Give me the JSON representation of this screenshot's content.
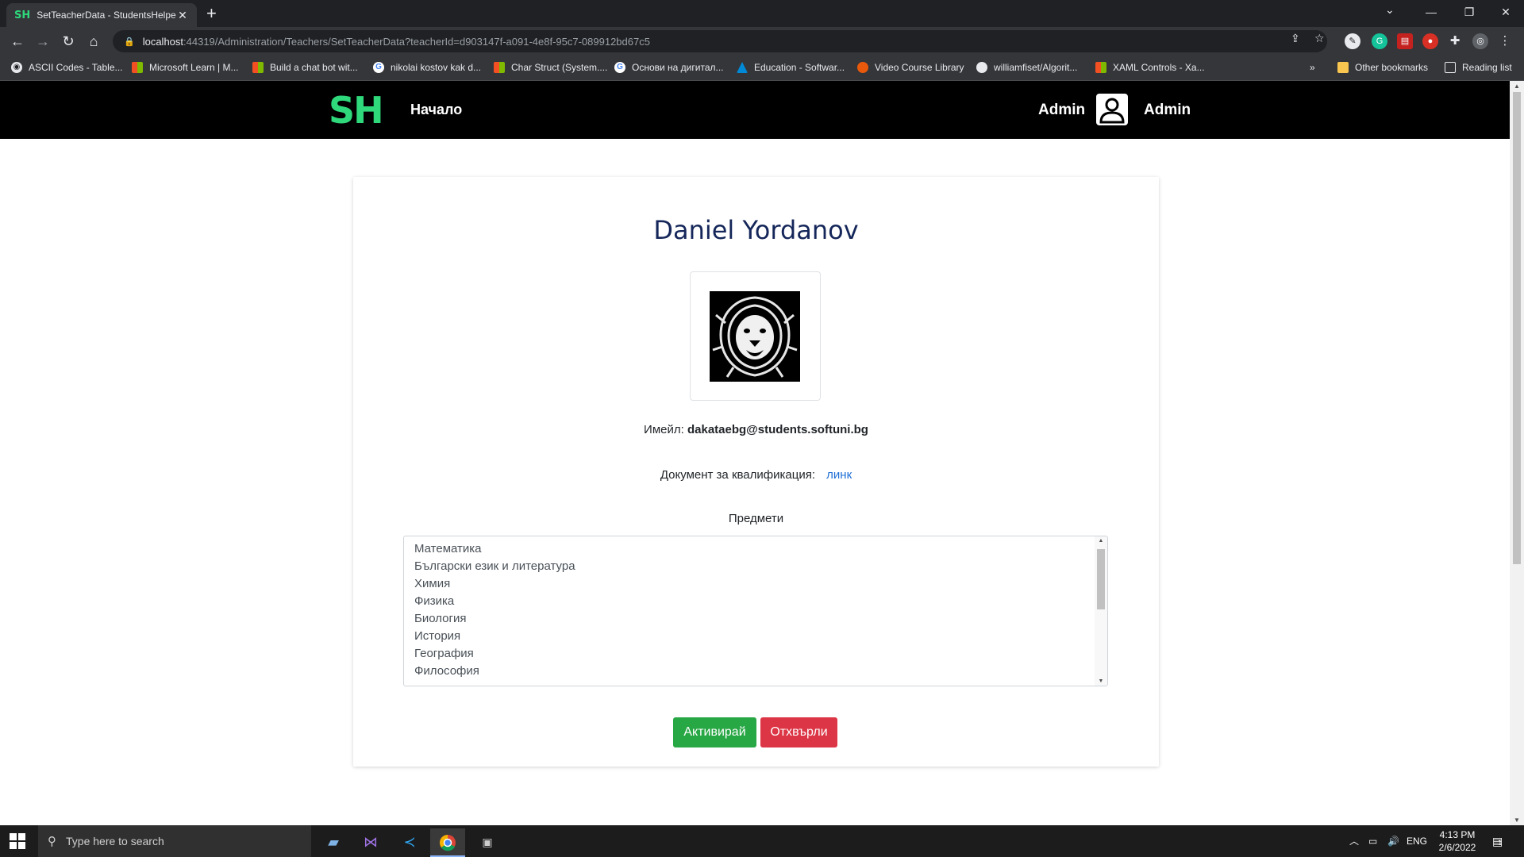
{
  "browser": {
    "tab_title": "SetTeacherData - StudentsHelper",
    "tab_favicon": "SH",
    "url_host": "localhost",
    "url_rest": ":44319/Administration/Teachers/SetTeacherData?teacherId=d903147f-a091-4e8f-95c7-089912bd67c5",
    "bookmarks": [
      {
        "label": "ASCII Codes - Table...",
        "icon": "globe-icon"
      },
      {
        "label": "Microsoft Learn | M...",
        "icon": "microsoft-icon"
      },
      {
        "label": "Build a chat bot wit...",
        "icon": "microsoft-icon"
      },
      {
        "label": "nikolai kostov kak d...",
        "icon": "google-icon"
      },
      {
        "label": "Char Struct (System....",
        "icon": "microsoft-icon"
      },
      {
        "label": "Основи на дигитал...",
        "icon": "google-icon"
      },
      {
        "label": "Education - Softwar...",
        "icon": "azure-icon"
      },
      {
        "label": "Video Course Library",
        "icon": "play-icon"
      },
      {
        "label": "williamfiset/Algorit...",
        "icon": "github-icon"
      },
      {
        "label": "XAML Controls - Xa...",
        "icon": "microsoft-icon"
      }
    ],
    "overflow": "»",
    "other_bookmarks": "Other bookmarks",
    "reading_list": "Reading list"
  },
  "site_nav": {
    "logo": "SH",
    "home": "Начало",
    "user_left": "Admin",
    "user_right": "Admin"
  },
  "teacher": {
    "name": "Daniel Yordanov",
    "email_label": "Имейл:",
    "email": "dakataebg@students.softuni.bg",
    "doc_label": "Документ за квалификация:",
    "doc_link": "линк",
    "subjects_label": "Предмети",
    "subjects": [
      "Математика",
      "Български език и литература",
      "Химия",
      "Физика",
      "Биология",
      "История",
      "География",
      "Философия"
    ]
  },
  "actions": {
    "activate": "Активирай",
    "reject": "Отхвърли"
  },
  "taskbar": {
    "search_placeholder": "Type here to search",
    "lang": "ENG",
    "time": "4:13 PM",
    "date": "2/6/2022",
    "notification_count": "1"
  },
  "colors": {
    "brand_green": "#2ed87b",
    "name_navy": "#15275a",
    "link_blue": "#1f6fd6",
    "success": "#28a745",
    "danger": "#dc3545"
  }
}
